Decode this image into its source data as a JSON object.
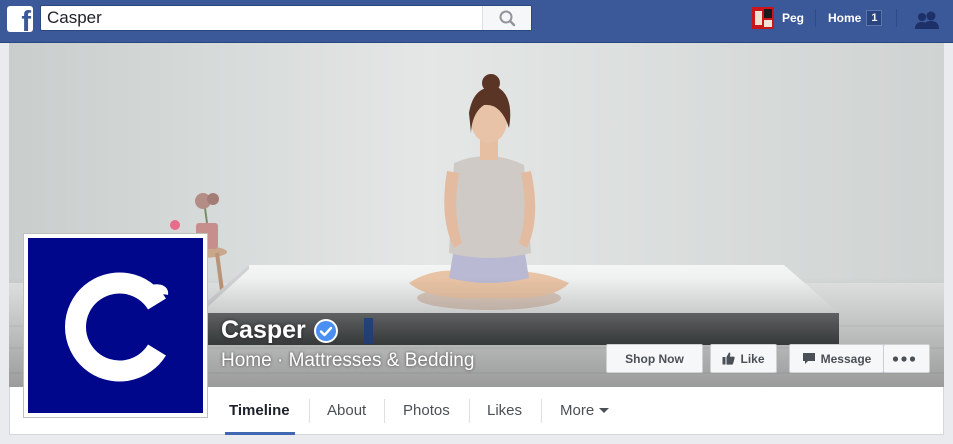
{
  "topbar": {
    "logo": "f",
    "search_value": "Casper",
    "search_icon": "search-icon",
    "user_name": "Peg",
    "home_label": "Home",
    "home_badge": "1",
    "friends_icon": "friends-icon",
    "brand_color": "#3b5998"
  },
  "page": {
    "name": "Casper",
    "verified_icon": "verified-check-icon",
    "category": "Home · Mattresses & Bedding",
    "logo_bg": "#00078a"
  },
  "actions": {
    "shop_now": "Shop Now",
    "like": "Like",
    "message": "Message",
    "more_icon": "ellipsis-icon"
  },
  "tabs": [
    {
      "label": "Timeline",
      "active": true
    },
    {
      "label": "About"
    },
    {
      "label": "Photos"
    },
    {
      "label": "Likes"
    },
    {
      "label": "More"
    }
  ]
}
